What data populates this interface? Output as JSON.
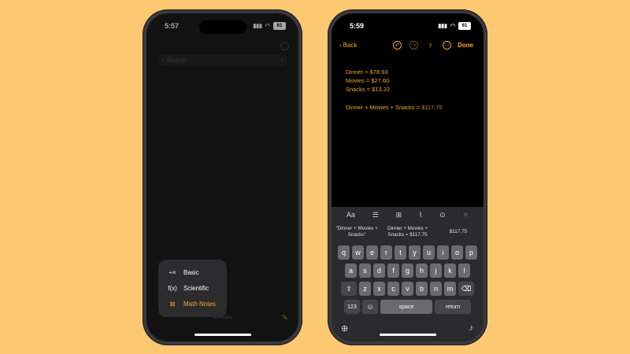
{
  "left_phone": {
    "status": {
      "time": "5:57",
      "battery": "61"
    },
    "search": {
      "placeholder": "Search"
    },
    "footer": "No Notes",
    "menu": {
      "items": [
        {
          "label": "Basic",
          "icon": "basic-calculator-icon",
          "glyph": "÷×",
          "active": false
        },
        {
          "label": "Scientific",
          "icon": "function-icon",
          "glyph": "f(x)",
          "active": false
        },
        {
          "label": "Math Notes",
          "icon": "math-notes-icon",
          "glyph": "⊠",
          "active": true
        }
      ]
    }
  },
  "right_phone": {
    "status": {
      "time": "5:59",
      "battery": "61"
    },
    "navbar": {
      "back_label": "Back",
      "done_label": "Done"
    },
    "note": {
      "lines": [
        "Dinner = $78.93",
        "Movies = $27.60",
        "Snacks = $13.22"
      ],
      "formula": "Dinner + Movies + Snacks = ",
      "result": "$117.75"
    },
    "keyboard": {
      "toolbar": [
        "Aa",
        "☰",
        "⊞",
        "⌇",
        "⊙",
        "✕"
      ],
      "suggestions": [
        "\"Dinner + Movies + Snacks\"",
        "Dinner + Movies + Snacks = $117.75",
        "$117.75"
      ],
      "row1": [
        "q",
        "w",
        "e",
        "r",
        "t",
        "y",
        "u",
        "i",
        "o",
        "p"
      ],
      "row2": [
        "a",
        "s",
        "d",
        "f",
        "g",
        "h",
        "j",
        "k",
        "l"
      ],
      "row3": [
        "z",
        "x",
        "c",
        "v",
        "b",
        "n",
        "m"
      ],
      "numbers_label": "123",
      "space_label": "space",
      "return_label": "return"
    }
  },
  "colors": {
    "background": "#fdc872",
    "accent": "#f5a623"
  }
}
